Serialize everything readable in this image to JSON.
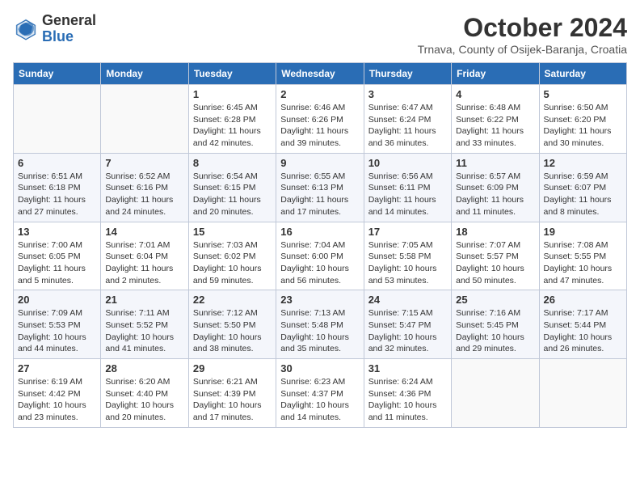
{
  "header": {
    "logo_general": "General",
    "logo_blue": "Blue",
    "month_title": "October 2024",
    "subtitle": "Trnava, County of Osijek-Baranja, Croatia"
  },
  "days_of_week": [
    "Sunday",
    "Monday",
    "Tuesday",
    "Wednesday",
    "Thursday",
    "Friday",
    "Saturday"
  ],
  "weeks": [
    [
      {
        "day": "",
        "sunrise": "",
        "sunset": "",
        "daylight": ""
      },
      {
        "day": "",
        "sunrise": "",
        "sunset": "",
        "daylight": ""
      },
      {
        "day": "1",
        "sunrise": "Sunrise: 6:45 AM",
        "sunset": "Sunset: 6:28 PM",
        "daylight": "Daylight: 11 hours and 42 minutes."
      },
      {
        "day": "2",
        "sunrise": "Sunrise: 6:46 AM",
        "sunset": "Sunset: 6:26 PM",
        "daylight": "Daylight: 11 hours and 39 minutes."
      },
      {
        "day": "3",
        "sunrise": "Sunrise: 6:47 AM",
        "sunset": "Sunset: 6:24 PM",
        "daylight": "Daylight: 11 hours and 36 minutes."
      },
      {
        "day": "4",
        "sunrise": "Sunrise: 6:48 AM",
        "sunset": "Sunset: 6:22 PM",
        "daylight": "Daylight: 11 hours and 33 minutes."
      },
      {
        "day": "5",
        "sunrise": "Sunrise: 6:50 AM",
        "sunset": "Sunset: 6:20 PM",
        "daylight": "Daylight: 11 hours and 30 minutes."
      }
    ],
    [
      {
        "day": "6",
        "sunrise": "Sunrise: 6:51 AM",
        "sunset": "Sunset: 6:18 PM",
        "daylight": "Daylight: 11 hours and 27 minutes."
      },
      {
        "day": "7",
        "sunrise": "Sunrise: 6:52 AM",
        "sunset": "Sunset: 6:16 PM",
        "daylight": "Daylight: 11 hours and 24 minutes."
      },
      {
        "day": "8",
        "sunrise": "Sunrise: 6:54 AM",
        "sunset": "Sunset: 6:15 PM",
        "daylight": "Daylight: 11 hours and 20 minutes."
      },
      {
        "day": "9",
        "sunrise": "Sunrise: 6:55 AM",
        "sunset": "Sunset: 6:13 PM",
        "daylight": "Daylight: 11 hours and 17 minutes."
      },
      {
        "day": "10",
        "sunrise": "Sunrise: 6:56 AM",
        "sunset": "Sunset: 6:11 PM",
        "daylight": "Daylight: 11 hours and 14 minutes."
      },
      {
        "day": "11",
        "sunrise": "Sunrise: 6:57 AM",
        "sunset": "Sunset: 6:09 PM",
        "daylight": "Daylight: 11 hours and 11 minutes."
      },
      {
        "day": "12",
        "sunrise": "Sunrise: 6:59 AM",
        "sunset": "Sunset: 6:07 PM",
        "daylight": "Daylight: 11 hours and 8 minutes."
      }
    ],
    [
      {
        "day": "13",
        "sunrise": "Sunrise: 7:00 AM",
        "sunset": "Sunset: 6:05 PM",
        "daylight": "Daylight: 11 hours and 5 minutes."
      },
      {
        "day": "14",
        "sunrise": "Sunrise: 7:01 AM",
        "sunset": "Sunset: 6:04 PM",
        "daylight": "Daylight: 11 hours and 2 minutes."
      },
      {
        "day": "15",
        "sunrise": "Sunrise: 7:03 AM",
        "sunset": "Sunset: 6:02 PM",
        "daylight": "Daylight: 10 hours and 59 minutes."
      },
      {
        "day": "16",
        "sunrise": "Sunrise: 7:04 AM",
        "sunset": "Sunset: 6:00 PM",
        "daylight": "Daylight: 10 hours and 56 minutes."
      },
      {
        "day": "17",
        "sunrise": "Sunrise: 7:05 AM",
        "sunset": "Sunset: 5:58 PM",
        "daylight": "Daylight: 10 hours and 53 minutes."
      },
      {
        "day": "18",
        "sunrise": "Sunrise: 7:07 AM",
        "sunset": "Sunset: 5:57 PM",
        "daylight": "Daylight: 10 hours and 50 minutes."
      },
      {
        "day": "19",
        "sunrise": "Sunrise: 7:08 AM",
        "sunset": "Sunset: 5:55 PM",
        "daylight": "Daylight: 10 hours and 47 minutes."
      }
    ],
    [
      {
        "day": "20",
        "sunrise": "Sunrise: 7:09 AM",
        "sunset": "Sunset: 5:53 PM",
        "daylight": "Daylight: 10 hours and 44 minutes."
      },
      {
        "day": "21",
        "sunrise": "Sunrise: 7:11 AM",
        "sunset": "Sunset: 5:52 PM",
        "daylight": "Daylight: 10 hours and 41 minutes."
      },
      {
        "day": "22",
        "sunrise": "Sunrise: 7:12 AM",
        "sunset": "Sunset: 5:50 PM",
        "daylight": "Daylight: 10 hours and 38 minutes."
      },
      {
        "day": "23",
        "sunrise": "Sunrise: 7:13 AM",
        "sunset": "Sunset: 5:48 PM",
        "daylight": "Daylight: 10 hours and 35 minutes."
      },
      {
        "day": "24",
        "sunrise": "Sunrise: 7:15 AM",
        "sunset": "Sunset: 5:47 PM",
        "daylight": "Daylight: 10 hours and 32 minutes."
      },
      {
        "day": "25",
        "sunrise": "Sunrise: 7:16 AM",
        "sunset": "Sunset: 5:45 PM",
        "daylight": "Daylight: 10 hours and 29 minutes."
      },
      {
        "day": "26",
        "sunrise": "Sunrise: 7:17 AM",
        "sunset": "Sunset: 5:44 PM",
        "daylight": "Daylight: 10 hours and 26 minutes."
      }
    ],
    [
      {
        "day": "27",
        "sunrise": "Sunrise: 6:19 AM",
        "sunset": "Sunset: 4:42 PM",
        "daylight": "Daylight: 10 hours and 23 minutes."
      },
      {
        "day": "28",
        "sunrise": "Sunrise: 6:20 AM",
        "sunset": "Sunset: 4:40 PM",
        "daylight": "Daylight: 10 hours and 20 minutes."
      },
      {
        "day": "29",
        "sunrise": "Sunrise: 6:21 AM",
        "sunset": "Sunset: 4:39 PM",
        "daylight": "Daylight: 10 hours and 17 minutes."
      },
      {
        "day": "30",
        "sunrise": "Sunrise: 6:23 AM",
        "sunset": "Sunset: 4:37 PM",
        "daylight": "Daylight: 10 hours and 14 minutes."
      },
      {
        "day": "31",
        "sunrise": "Sunrise: 6:24 AM",
        "sunset": "Sunset: 4:36 PM",
        "daylight": "Daylight: 10 hours and 11 minutes."
      },
      {
        "day": "",
        "sunrise": "",
        "sunset": "",
        "daylight": ""
      },
      {
        "day": "",
        "sunrise": "",
        "sunset": "",
        "daylight": ""
      }
    ]
  ]
}
